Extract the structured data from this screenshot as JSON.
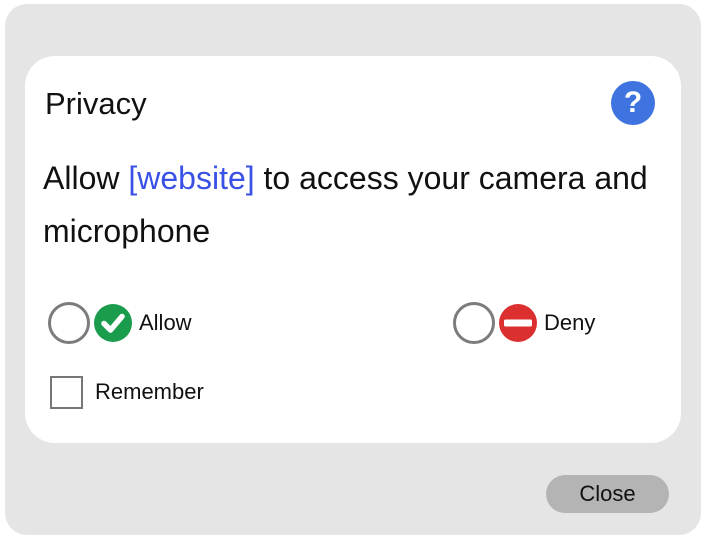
{
  "dialog": {
    "title": "Privacy",
    "help_label": "?",
    "message": {
      "before": "Allow ",
      "site": "[website]",
      "after": " to access your camera and microphone"
    },
    "options": {
      "allow": {
        "label": "Allow",
        "icon": "check-circle-icon",
        "color": "#1b9c4d",
        "selected": false
      },
      "deny": {
        "label": "Deny",
        "icon": "no-entry-icon",
        "color": "#dc2f2f",
        "selected": false
      }
    },
    "remember": {
      "label": "Remember",
      "checked": false
    },
    "close_label": "Close"
  },
  "colors": {
    "help_button": "#3f73e0",
    "link": "#3a51e6",
    "dialog_background": "#e5e5e5",
    "close_button": "#b4b4b4"
  }
}
